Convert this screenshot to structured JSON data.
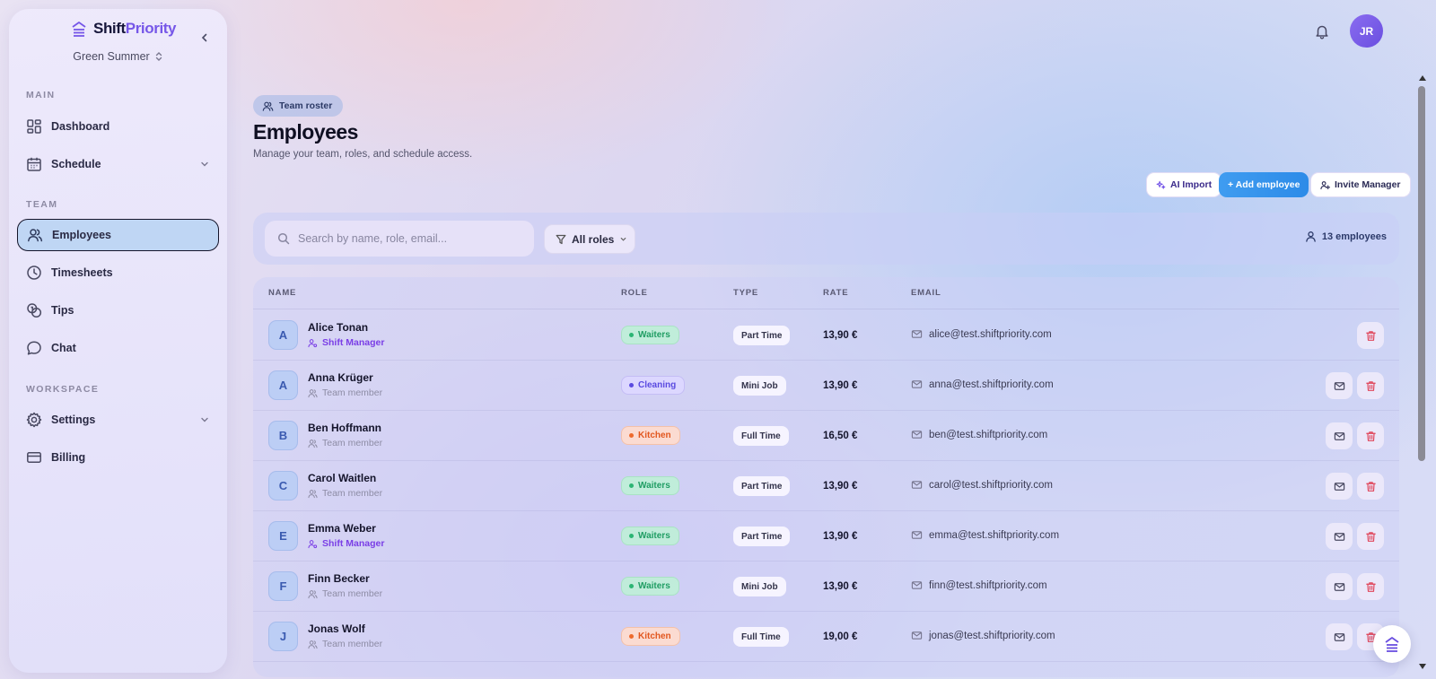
{
  "brand": {
    "name_part1": "Shift",
    "name_part2": "Priority",
    "workspace": "Green Summer"
  },
  "sidebar": {
    "sections": {
      "main": "MAIN",
      "team": "TEAM",
      "workspace": "WORKSPACE"
    },
    "items": [
      {
        "label": "Dashboard",
        "icon": "dashboard-icon"
      },
      {
        "label": "Schedule",
        "icon": "calendar-icon",
        "has_chevron": true
      },
      {
        "label": "Employees",
        "icon": "users-icon",
        "active": true
      },
      {
        "label": "Timesheets",
        "icon": "clock-icon"
      },
      {
        "label": "Tips",
        "icon": "coins-icon"
      },
      {
        "label": "Chat",
        "icon": "chat-icon"
      },
      {
        "label": "Settings",
        "icon": "gear-icon",
        "has_chevron": true
      },
      {
        "label": "Billing",
        "icon": "credit-card-icon"
      }
    ]
  },
  "topbar": {
    "user_initials": "JR"
  },
  "header": {
    "badge": "Team roster",
    "title": "Employees",
    "subtitle": "Manage your team, roles, and schedule access."
  },
  "actions": {
    "ai_import": "AI Import",
    "add_employee": "+ Add employee",
    "invite_manager": "Invite Manager"
  },
  "filters": {
    "search_placeholder": "Search by name, role, email...",
    "role_filter": "All roles",
    "count": "13 employees"
  },
  "table": {
    "columns": [
      "NAME",
      "ROLE",
      "TYPE",
      "RATE",
      "EMAIL"
    ],
    "rows": [
      {
        "initial": "A",
        "name": "Alice Tonan",
        "position": "Shift Manager",
        "role": "Waiters",
        "type": "Part Time",
        "rate": "13,90 €",
        "email": "alice@test.shiftpriority.com"
      },
      {
        "initial": "A",
        "name": "Anna Krüger",
        "position": "Team member",
        "role": "Cleaning",
        "type": "Mini Job",
        "rate": "13,90 €",
        "email": "anna@test.shiftpriority.com"
      },
      {
        "initial": "B",
        "name": "Ben Hoffmann",
        "position": "Team member",
        "role": "Kitchen",
        "type": "Full Time",
        "rate": "16,50 €",
        "email": "ben@test.shiftpriority.com"
      },
      {
        "initial": "C",
        "name": "Carol Waitlen",
        "position": "Team member",
        "role": "Waiters",
        "type": "Part Time",
        "rate": "13,90 €",
        "email": "carol@test.shiftpriority.com"
      },
      {
        "initial": "E",
        "name": "Emma Weber",
        "position": "Shift Manager",
        "role": "Waiters",
        "type": "Part Time",
        "rate": "13,90 €",
        "email": "emma@test.shiftpriority.com"
      },
      {
        "initial": "F",
        "name": "Finn Becker",
        "position": "Team member",
        "role": "Waiters",
        "type": "Mini Job",
        "rate": "13,90 €",
        "email": "finn@test.shiftpriority.com"
      },
      {
        "initial": "J",
        "name": "Jonas Wolf",
        "position": "Team member",
        "role": "Kitchen",
        "type": "Full Time",
        "rate": "19,00 €",
        "email": "jonas@test.shiftpriority.com"
      }
    ]
  },
  "colors": {
    "accent": "#7657e8",
    "primary_button": "#2c8be8",
    "waiters": "#1f9d63",
    "cleaning": "#5a4ae0",
    "kitchen": "#e2571f",
    "delete": "#e0455a"
  }
}
